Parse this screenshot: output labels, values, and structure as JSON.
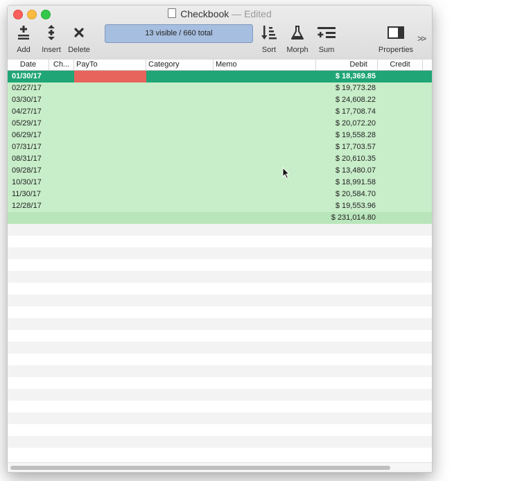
{
  "window": {
    "title": "Checkbook",
    "separator": "—",
    "status": "Edited"
  },
  "toolbar": {
    "add": "Add",
    "insert": "Insert",
    "delete": "Delete",
    "status_text": "13 visible / 660 total",
    "sort": "Sort",
    "morph": "Morph",
    "sum": "Sum",
    "properties": "Properties",
    "overflow": ">>"
  },
  "columns": [
    "Date",
    "Ch...",
    "PayTo",
    "Category",
    "Memo",
    "Debit",
    "Credit"
  ],
  "rows": [
    {
      "date": "01/30/17",
      "debit": "$ 18,369.85"
    },
    {
      "date": "02/27/17",
      "debit": "$ 19,773.28"
    },
    {
      "date": "03/30/17",
      "debit": "$ 24,608.22"
    },
    {
      "date": "04/27/17",
      "debit": "$ 17,708.74"
    },
    {
      "date": "05/29/17",
      "debit": "$ 20,072.20"
    },
    {
      "date": "06/29/17",
      "debit": "$ 19,558.28"
    },
    {
      "date": "07/31/17",
      "debit": "$ 17,703.57"
    },
    {
      "date": "08/31/17",
      "debit": "$ 20,610.35"
    },
    {
      "date": "09/28/17",
      "debit": "$ 13,480.07"
    },
    {
      "date": "10/30/17",
      "debit": "$ 18,991.58"
    },
    {
      "date": "11/30/17",
      "debit": "$ 20,584.70"
    },
    {
      "date": "12/28/17",
      "debit": "$ 19,553.96"
    }
  ],
  "total": {
    "debit": "$ 231,014.80"
  },
  "colors": {
    "selected_row": "#1fa576",
    "group_row": "#c8edc9",
    "total_row": "#b9e5bb",
    "payto_flag": "#e6645c",
    "status_bg": "#a6bedf"
  }
}
